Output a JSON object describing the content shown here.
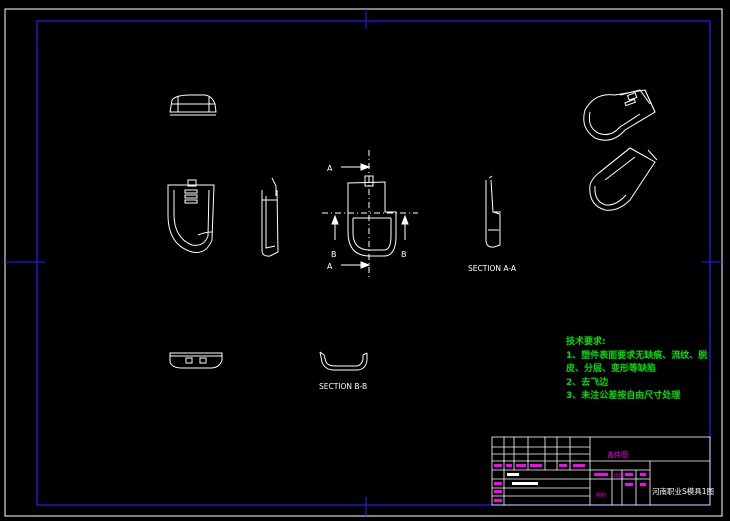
{
  "labels": {
    "section_a_top": "A",
    "section_a_bottom": "A",
    "section_b_left": "B",
    "section_b_right": "B",
    "section_aa": "SECTION A-A",
    "section_bb": "SECTION B-B"
  },
  "notes": {
    "heading": "技术要求:",
    "line1": "1、塑件表面要求无缺痕、流纹、脱",
    "line2": "皮、分层、变形等缺陷",
    "line3": "2、去飞边",
    "line4": "3、未注公差按自由尺寸处理"
  },
  "title_block": {
    "part_name": "盖件图",
    "drawing_title": "河南职业S模具1图",
    "scale_label": "比例",
    "material_label": "材料"
  },
  "colors": {
    "border": "#ffffff",
    "frame": "#2222ff",
    "outline": "#ffffff",
    "dim": "#ffffff",
    "notes": "#00e000",
    "title_text": "#ff00ff",
    "center": "#ff3333"
  }
}
